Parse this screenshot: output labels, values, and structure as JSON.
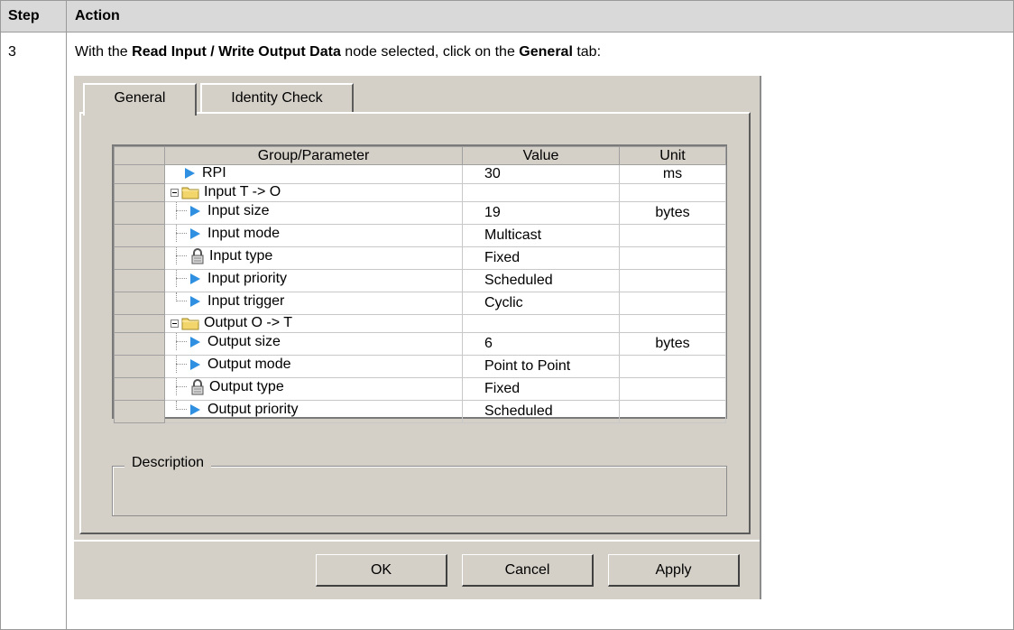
{
  "table_header": {
    "step": "Step",
    "action": "Action"
  },
  "step_number": "3",
  "instruction": {
    "part1": "With the ",
    "bold1": "Read Input / Write Output Data",
    "part2": " node selected, click on the ",
    "bold2": "General",
    "part3": " tab:"
  },
  "dialog": {
    "tabs": [
      {
        "label": "General",
        "active": true
      },
      {
        "label": "Identity Check",
        "active": false
      }
    ],
    "grid": {
      "columns": [
        "Group/Parameter",
        "Value",
        "Unit"
      ],
      "rows": [
        {
          "name": "RPI",
          "value": "30",
          "unit": "ms",
          "icon": "parameter-arrow-icon"
        },
        {
          "name": "Input T -> O",
          "value": "",
          "unit": "",
          "icon": "folder-icon"
        },
        {
          "name": "Input size",
          "value": "19",
          "unit": "bytes",
          "icon": "parameter-arrow-icon"
        },
        {
          "name": "Input mode",
          "value": "Multicast",
          "unit": "",
          "icon": "parameter-arrow-icon"
        },
        {
          "name": "Input type",
          "value": "Fixed",
          "unit": "",
          "icon": "lock-icon"
        },
        {
          "name": "Input priority",
          "value": "Scheduled",
          "unit": "",
          "icon": "parameter-arrow-icon"
        },
        {
          "name": "Input trigger",
          "value": "Cyclic",
          "unit": "",
          "icon": "parameter-arrow-icon"
        },
        {
          "name": "Output O -> T",
          "value": "",
          "unit": "",
          "icon": "folder-icon"
        },
        {
          "name": "Output size",
          "value": "6",
          "unit": "bytes",
          "icon": "parameter-arrow-icon"
        },
        {
          "name": "Output mode",
          "value": "Point to Point",
          "unit": "",
          "icon": "parameter-arrow-icon"
        },
        {
          "name": "Output type",
          "value": "Fixed",
          "unit": "",
          "icon": "lock-icon"
        },
        {
          "name": "Output priority",
          "value": "Scheduled",
          "unit": "",
          "icon": "parameter-arrow-icon"
        }
      ]
    },
    "description_label": "Description",
    "buttons": {
      "ok": "OK",
      "cancel": "Cancel",
      "apply": "Apply"
    }
  }
}
